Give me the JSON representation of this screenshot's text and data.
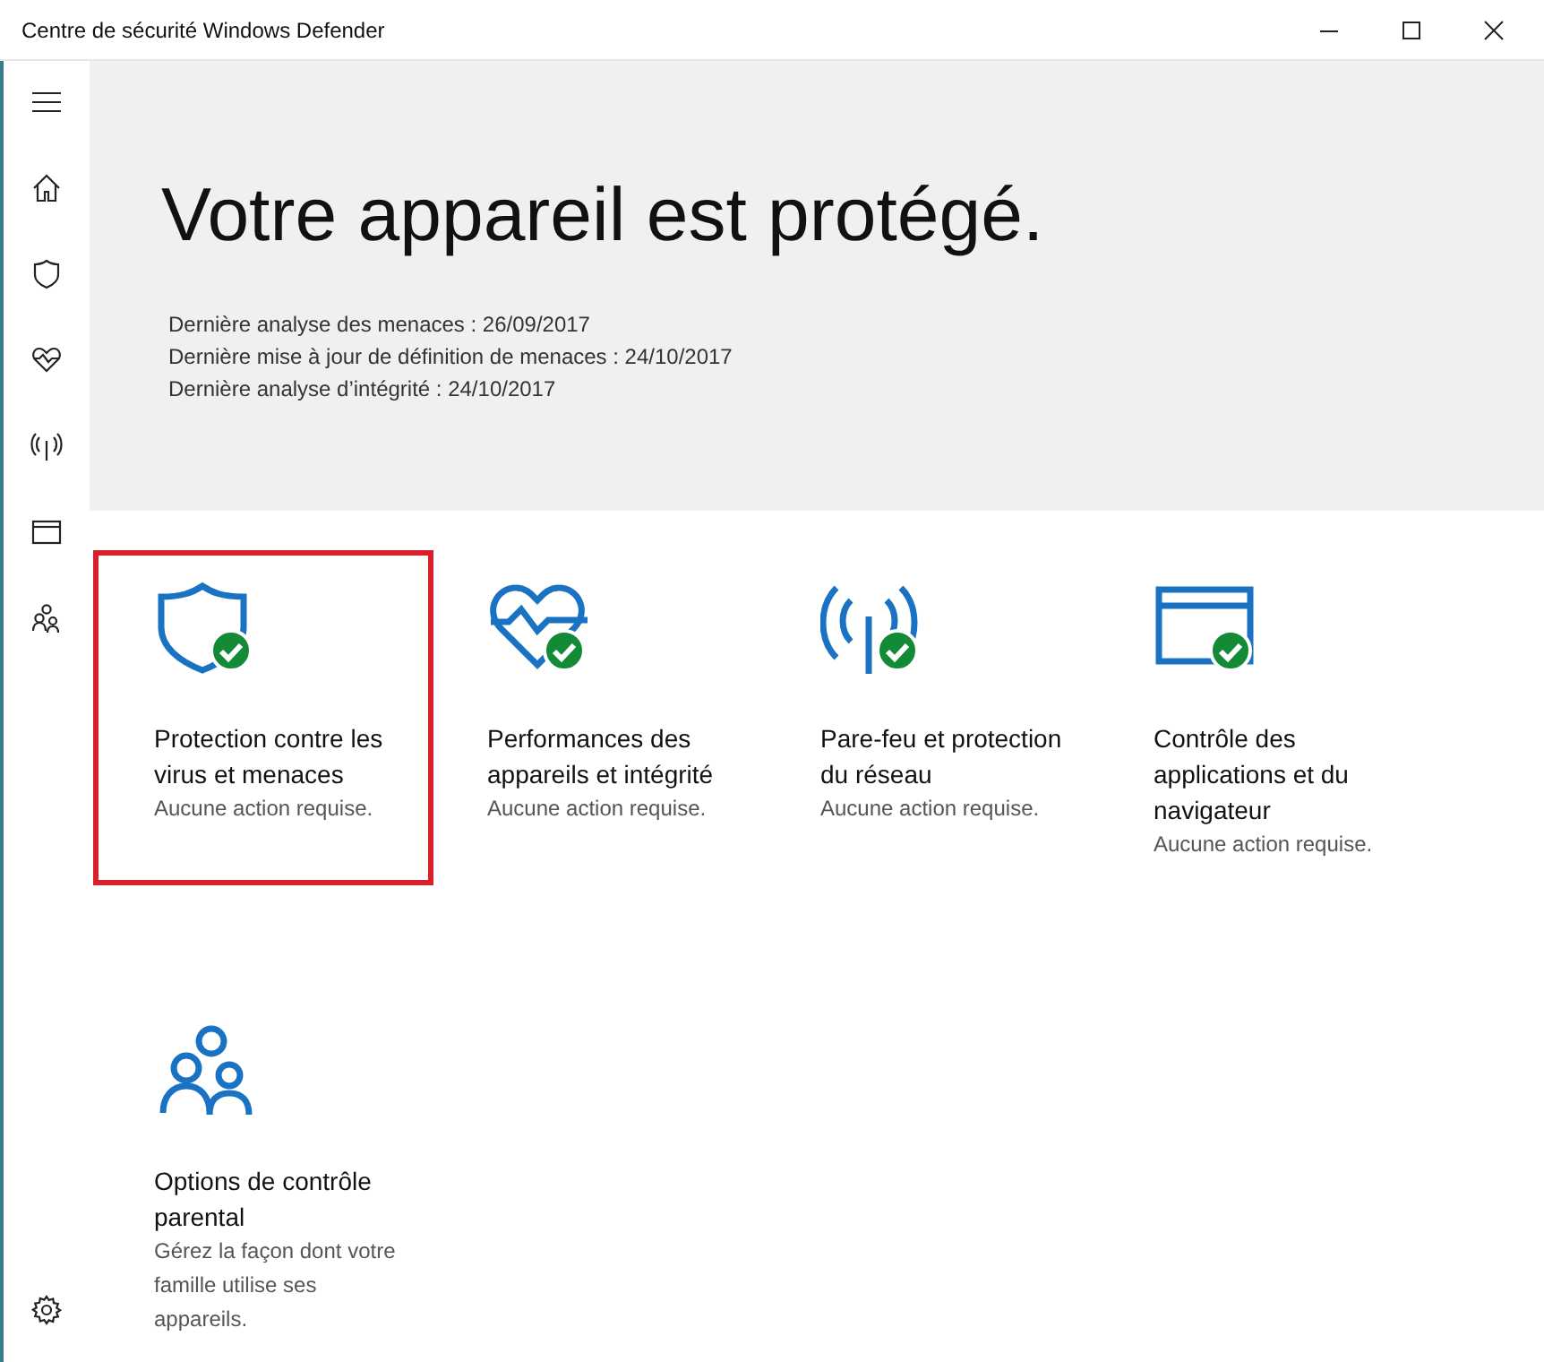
{
  "window": {
    "title": "Centre de sécurité Windows Defender"
  },
  "sidebar": {
    "items": [
      {
        "kind": "menu"
      },
      {
        "kind": "home"
      },
      {
        "kind": "shield"
      },
      {
        "kind": "heart"
      },
      {
        "kind": "antenna"
      },
      {
        "kind": "browser"
      },
      {
        "kind": "family"
      }
    ],
    "footer": {
      "kind": "settings"
    }
  },
  "hero": {
    "title": "Votre appareil est protégé.",
    "details": [
      "Dernière analyse des menaces :  26/09/2017",
      "Dernière mise à jour de définition de menaces :  24/10/2017",
      "Dernière analyse d’intégrité :  24/10/2017"
    ]
  },
  "tiles": [
    {
      "kind": "shield",
      "title": "Protection contre les virus et menaces",
      "status": "Aucune action requise.",
      "ok": true,
      "highlighted": true
    },
    {
      "kind": "heart",
      "title": "Performances des appareils et intégrité",
      "status": "Aucune action requise.",
      "ok": true,
      "highlighted": false
    },
    {
      "kind": "antenna",
      "title": "Pare-feu et protection du réseau",
      "status": "Aucune action requise.",
      "ok": true,
      "highlighted": false
    },
    {
      "kind": "browser",
      "title": "Contrôle des applications et du navigateur",
      "status": "Aucune action requise.",
      "ok": true,
      "highlighted": false
    },
    {
      "kind": "family",
      "title": "Options de contrôle parental",
      "status": "Gérez la façon dont votre famille utilise ses appareils.",
      "ok": false,
      "highlighted": false
    }
  ]
}
